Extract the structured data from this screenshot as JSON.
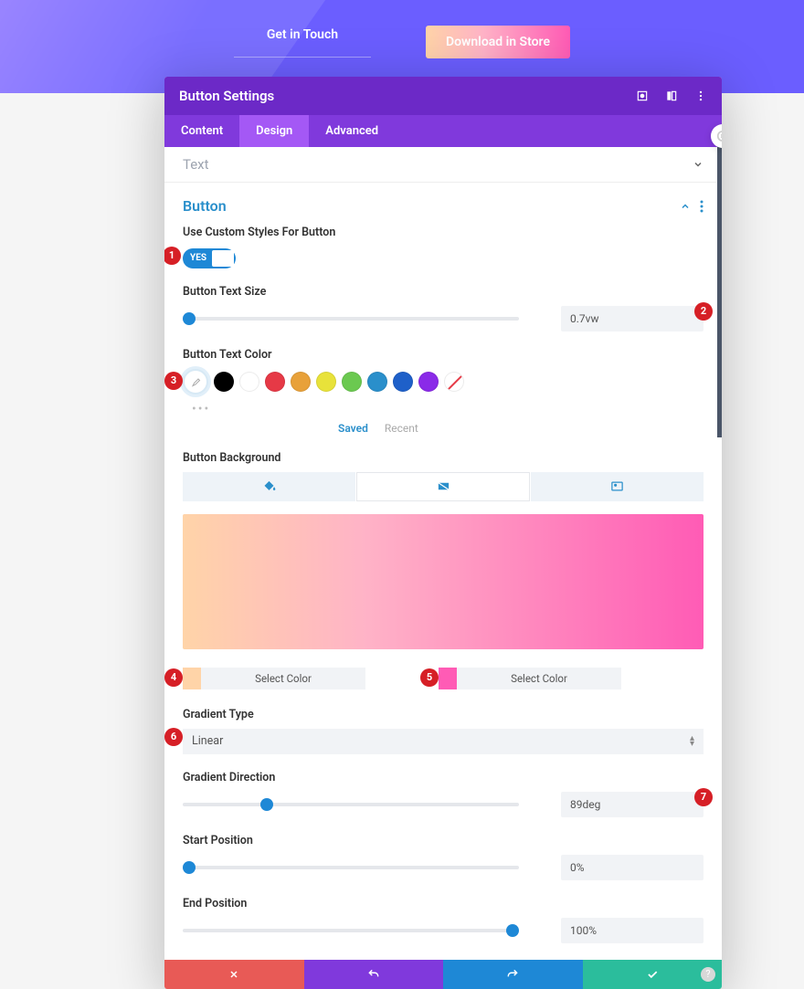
{
  "hero": {
    "link_label": "Get in Touch",
    "button_label": "Download in Store"
  },
  "modal": {
    "title": "Button Settings",
    "tabs": {
      "content": "Content",
      "design": "Design",
      "advanced": "Advanced"
    }
  },
  "sections": {
    "text_collapsed": "Text",
    "button_title": "Button"
  },
  "fields": {
    "use_custom_label": "Use Custom Styles For Button",
    "toggle_yes": "YES",
    "text_size_label": "Button Text Size",
    "text_size_value": "0.7vw",
    "text_color_label": "Button Text Color",
    "saved_tab": "Saved",
    "recent_tab": "Recent",
    "background_label": "Button Background",
    "select_color_label": "Select Color",
    "gradient_type_label": "Gradient Type",
    "gradient_type_value": "Linear",
    "gradient_direction_label": "Gradient Direction",
    "gradient_direction_value": "89deg",
    "start_pos_label": "Start Position",
    "start_pos_value": "0%",
    "end_pos_label": "End Position",
    "end_pos_value": "100%"
  },
  "swatches": {
    "black": "#000000",
    "white": "#ffffff",
    "red": "#e63946",
    "orange": "#e8a13a",
    "yellow": "#e8e23a",
    "green": "#6bc950",
    "teal": "#2a8fcb",
    "blue": "#1e60c9",
    "purple": "#8a2ae8"
  },
  "gradient_colors": {
    "start": "#ffd4a8",
    "end": "#ff5bb5"
  },
  "callouts": {
    "c1": "1",
    "c2": "2",
    "c3": "3",
    "c4": "4",
    "c5": "5",
    "c6": "6",
    "c7": "7"
  }
}
